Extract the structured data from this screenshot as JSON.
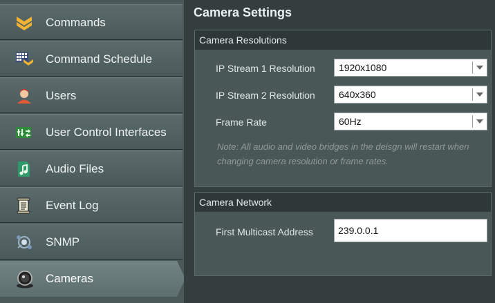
{
  "sidebar": {
    "items": [
      {
        "label": "Commands",
        "icon": "chevrons-icon",
        "active": false
      },
      {
        "label": "Command Schedule",
        "icon": "schedule-grid-icon",
        "active": false
      },
      {
        "label": "Users",
        "icon": "user-icon",
        "active": false
      },
      {
        "label": "User Control Interfaces",
        "icon": "control-interface-icon",
        "active": false
      },
      {
        "label": "Audio Files",
        "icon": "audio-file-icon",
        "active": false
      },
      {
        "label": "Event Log",
        "icon": "scroll-icon",
        "active": false
      },
      {
        "label": "SNMP",
        "icon": "snmp-icon",
        "active": false
      },
      {
        "label": "Cameras",
        "icon": "camera-icon",
        "active": true
      }
    ]
  },
  "main": {
    "title": "Camera Settings",
    "resolutions": {
      "header": "Camera Resolutions",
      "stream1_label": "IP Stream 1 Resolution",
      "stream1_value": "1920x1080",
      "stream2_label": "IP Stream 2 Resolution",
      "stream2_value": "640x360",
      "framerate_label": "Frame Rate",
      "framerate_value": "60Hz",
      "note": "Note: All audio and video bridges in the deisgn will restart when changing camera resolution or frame rates."
    },
    "network": {
      "header": "Camera Network",
      "multicast_label": "First Multicast Address",
      "multicast_value": "239.0.0.1"
    }
  }
}
